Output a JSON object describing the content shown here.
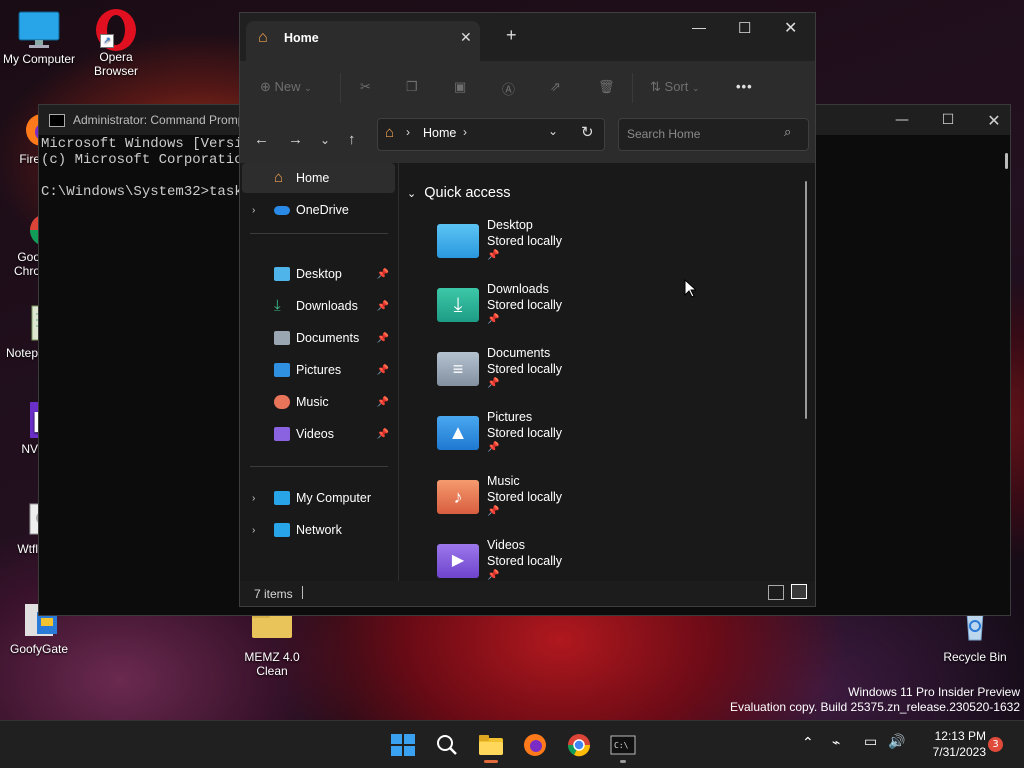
{
  "desktop": {
    "icons": [
      {
        "label": "My Computer"
      },
      {
        "label": "Opera\nBrowser"
      },
      {
        "label": "Fire"
      },
      {
        "label": "Goo\nChro"
      },
      {
        "label": "Notep"
      },
      {
        "label": "NV"
      },
      {
        "label": "WtflsV"
      },
      {
        "label": "GoofyGate"
      },
      {
        "label": "MEMZ 4.0\nClean"
      },
      {
        "label": "Recycle Bin"
      }
    ],
    "watermark": {
      "line1": "Windows 11 Pro Insider Preview",
      "line2": "Evaluation copy. Build 25375.zn_release.230520-1632"
    }
  },
  "cmd": {
    "title": "Administrator: Command Promp",
    "lines": [
      "Microsoft Windows [Versio",
      "(c) Microsoft Corporation",
      "",
      "C:\\Windows\\System32>taskk"
    ]
  },
  "explorer": {
    "tab_title": "Home",
    "new_tab": "+",
    "toolbar": {
      "new_label": "New",
      "sort_label": "Sort",
      "more_label": "•••"
    },
    "address": {
      "home": "Home",
      "sep": ">"
    },
    "search_placeholder": "Search Home",
    "sidebar": {
      "home": "Home",
      "onedrive": "OneDrive",
      "pinned": [
        {
          "label": "Desktop",
          "color": "#4fb4ea"
        },
        {
          "label": "Downloads",
          "color": "#3fbf8f"
        },
        {
          "label": "Documents",
          "color": "#9aa6b2"
        },
        {
          "label": "Pictures",
          "color": "#2f8fe0"
        },
        {
          "label": "Music",
          "color": "#e8745a"
        },
        {
          "label": "Videos",
          "color": "#8a63e0"
        }
      ],
      "mycomputer": "My Computer",
      "network": "Network"
    },
    "quick_access": {
      "title": "Quick access",
      "items": [
        {
          "name": "Desktop",
          "sub": "Stored locally",
          "color": "#47b0ea"
        },
        {
          "name": "Downloads",
          "sub": "Stored locally",
          "color": "#2fb39a"
        },
        {
          "name": "Documents",
          "sub": "Stored locally",
          "color": "#9aa9b8"
        },
        {
          "name": "Pictures",
          "sub": "Stored locally",
          "color": "#2f8fe0"
        },
        {
          "name": "Music",
          "sub": "Stored locally",
          "color": "#ef7e5a"
        },
        {
          "name": "Videos",
          "sub": "Stored locally",
          "color": "#8a5fe0"
        }
      ]
    },
    "status": "7 items"
  },
  "taskbar": {
    "clock_time": "12:13 PM",
    "clock_date": "7/31/2023",
    "notif_count": "3"
  }
}
